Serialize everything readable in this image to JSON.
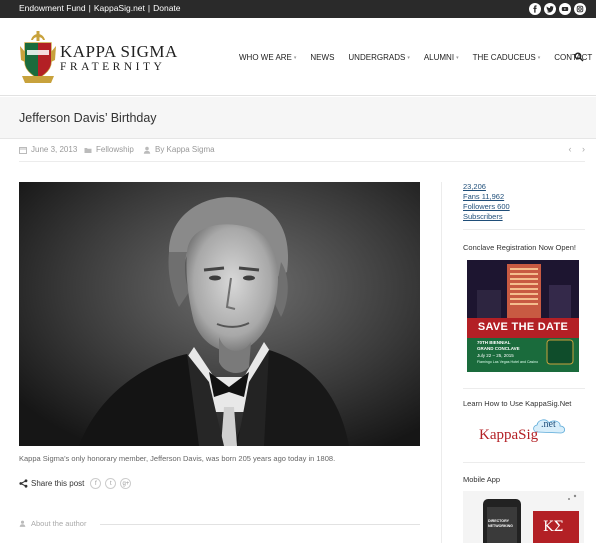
{
  "topbar": {
    "links": [
      "Endowment Fund",
      "KappaSig.net",
      "Donate"
    ],
    "separator": "|",
    "social_icons": [
      "facebook-icon",
      "twitter-icon",
      "youtube-icon",
      "instagram-icon"
    ]
  },
  "logo": {
    "line1": "KAPPA SIGMA",
    "line2": "FRATERNITY"
  },
  "nav": {
    "items": [
      {
        "label": "WHO WE ARE",
        "dropdown": true
      },
      {
        "label": "NEWS",
        "dropdown": false
      },
      {
        "label": "UNDERGRADS",
        "dropdown": true
      },
      {
        "label": "ALUMNI",
        "dropdown": true
      },
      {
        "label": "THE CADUCEUS",
        "dropdown": true
      },
      {
        "label": "CONTACT",
        "dropdown": false
      }
    ],
    "search_icon": "search-icon"
  },
  "post": {
    "title": "Jefferson Davis’ Birthday",
    "date": "June 3, 2013",
    "category": "Fellowship",
    "author": "By Kappa Sigma",
    "prev": "‹",
    "next": "›",
    "caption": "Kappa Sigma’s only honorary member, Jefferson Davis, was born 205 years ago today in 1808.",
    "share_label": "Share this post",
    "share_buttons": [
      "f",
      "t",
      "g+"
    ],
    "about_author": "About the author"
  },
  "sidebar": {
    "stats": [
      "23,206",
      "Fans 11,962",
      "Followers 600",
      "Subscribers"
    ],
    "widgets": {
      "conclave_title": "Conclave Registration Now Open!",
      "conclave_save": "SAVE THE DATE",
      "conclave_sub1": "70TH BIENNIAL",
      "conclave_sub2": "GRAND CONCLAVE",
      "conclave_dates": "July 22 – 25, 2015",
      "conclave_venue": "Flamingo Las Vegas Hotel and Casino",
      "kappasignet_title": "Learn How to Use KappaSig.Net",
      "kappasignet_logo_text": "KappaSig",
      "kappasignet_logo_suffix": ".net",
      "mobile_title": "Mobile App",
      "mobile_phone_text": "DIRECTORY NETWORKING",
      "mobile_letters": "ΚΣ"
    }
  },
  "colors": {
    "topbar_bg": "#2a2a2a",
    "brand_green": "#1a6b3c",
    "brand_red": "#b32025",
    "link_blue": "#1f4e79"
  }
}
